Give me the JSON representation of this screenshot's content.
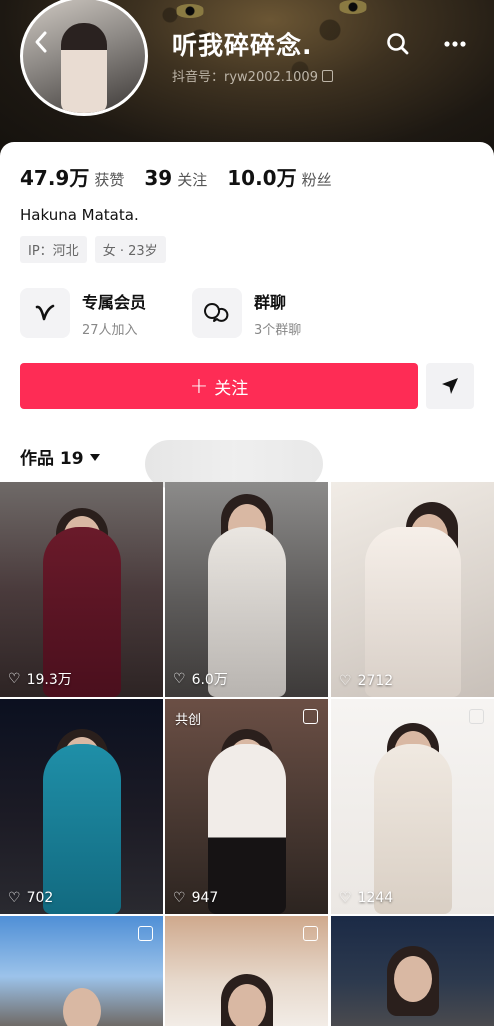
{
  "header": {
    "back_icon": "chevron-left-icon",
    "name": "听我碎碎念.",
    "account_id": "抖音号：ryw2002.1009",
    "search_icon": "search-icon",
    "more_icon": "more-horizontal-icon"
  },
  "stats": [
    {
      "value": "47.9万",
      "label": "获赞"
    },
    {
      "value": "39",
      "label": "关注"
    },
    {
      "value": "10.0万",
      "label": "粉丝"
    }
  ],
  "bio": "Hakuna Matata.",
  "tags": [
    "IP：河北",
    "女 · 23岁"
  ],
  "features": [
    {
      "title": "专属会员",
      "subtitle": "27人加入",
      "icon": "v-logo-icon"
    },
    {
      "title": "群聊",
      "subtitle": "3个群聊",
      "icon": "chat-bubble-icon"
    }
  ],
  "actions": {
    "follow_plus": "+",
    "follow_label": "关注",
    "share_icon": "send-arrow-icon"
  },
  "works_tab": {
    "label": "作品 19"
  },
  "grid": [
    {
      "likes": "19.3万"
    },
    {
      "likes": "6.0万"
    },
    {
      "likes": "2712"
    },
    {
      "likes": "702"
    },
    {
      "likes": "947",
      "badge": "共创"
    },
    {
      "likes": "1244"
    },
    {
      "likes": ""
    },
    {
      "likes": ""
    },
    {
      "likes": ""
    }
  ],
  "colors": {
    "accent": "#fe2c55",
    "tag_bg": "#f2f2f4"
  }
}
